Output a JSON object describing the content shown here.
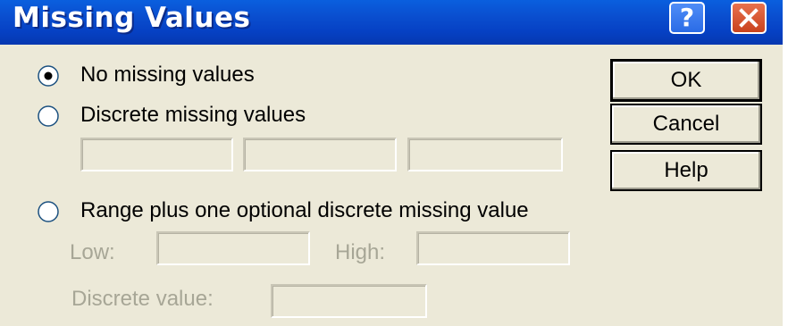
{
  "window": {
    "title": "Missing Values"
  },
  "title_buttons": {
    "help_symbol": "?",
    "help_icon": "help-icon",
    "close_icon": "close-icon"
  },
  "options": {
    "no_missing": {
      "label": "No missing values",
      "selected": true
    },
    "discrete": {
      "label": "Discrete missing values",
      "selected": false,
      "values": [
        "",
        "",
        ""
      ]
    },
    "range": {
      "label": "Range plus one optional discrete missing value",
      "selected": false
    }
  },
  "range_fields": {
    "low_label": "Low:",
    "low_value": "",
    "high_label": "High:",
    "high_value": "",
    "discrete_label": "Discrete value:",
    "discrete_value": ""
  },
  "buttons": {
    "ok": "OK",
    "cancel": "Cancel",
    "help": "Help"
  },
  "colors": {
    "dialog_bg": "#ece9d8",
    "titlebar": "#0a4fd0",
    "disabled_text": "#a7a696",
    "close_red": "#c9421d"
  }
}
